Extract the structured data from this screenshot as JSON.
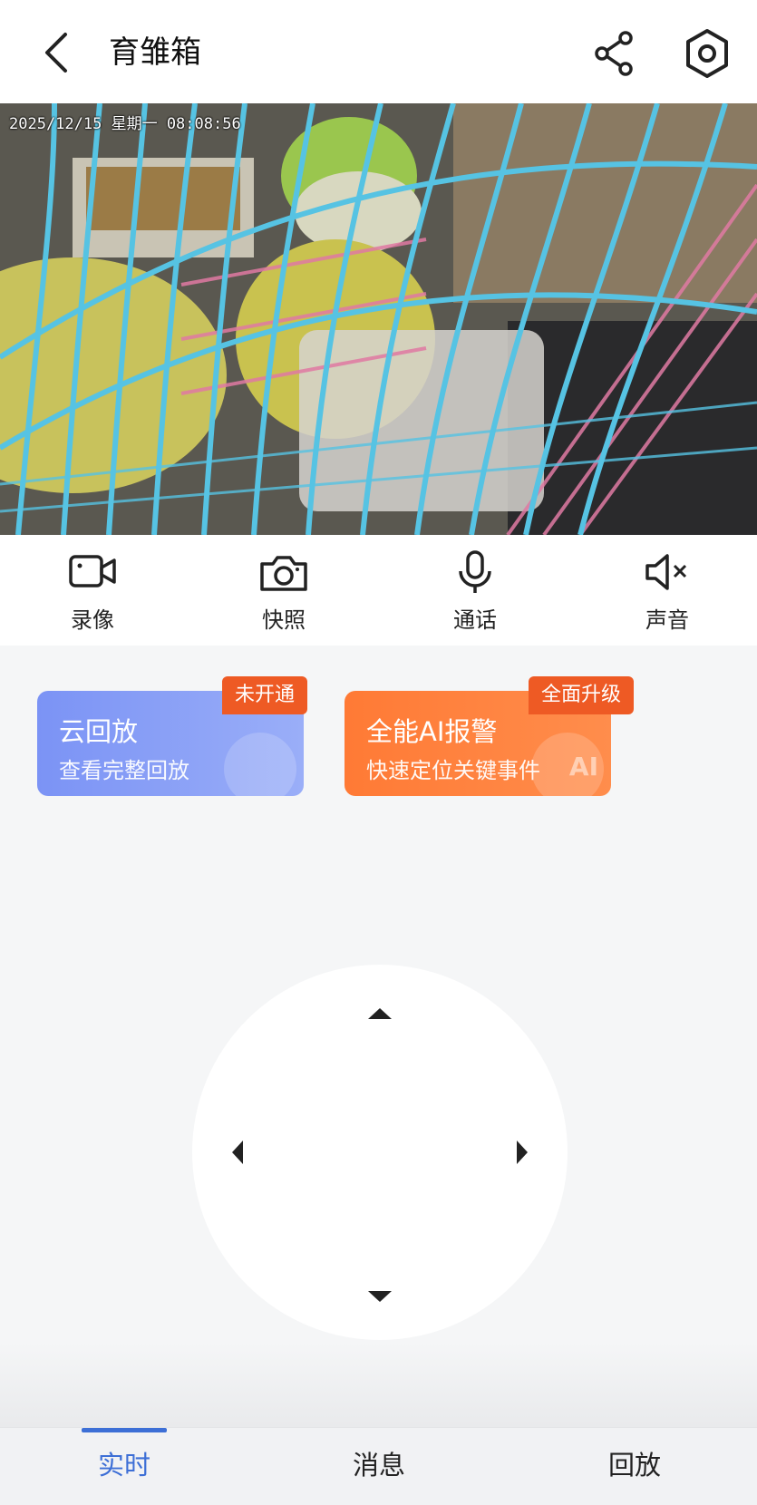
{
  "header": {
    "title": "育雏箱",
    "back_icon": "chevron-left-icon",
    "share_icon": "share-icon",
    "settings_icon": "hex-nut-settings-icon"
  },
  "video": {
    "timestamp": "2025/12/15 星期一 08:08:56"
  },
  "controls": [
    {
      "label": "录像",
      "icon": "video-record-icon"
    },
    {
      "label": "快照",
      "icon": "camera-icon"
    },
    {
      "label": "通话",
      "icon": "microphone-icon"
    },
    {
      "label": "声音",
      "icon": "speaker-muted-icon"
    }
  ],
  "cards": {
    "cloud": {
      "title": "云回放",
      "subtitle": "查看完整回放",
      "badge": "未开通",
      "color": "#7b93f5"
    },
    "ai": {
      "title": "全能AI报警",
      "subtitle": "快速定位关键事件",
      "badge": "全面升级",
      "deco": "AI",
      "color": "#ff7a35"
    }
  },
  "ptz": {
    "icons": [
      "arrow-up-icon",
      "arrow-down-icon",
      "arrow-left-icon",
      "arrow-right-icon"
    ]
  },
  "tabs": [
    {
      "label": "实时",
      "active": true
    },
    {
      "label": "消息",
      "active": false
    },
    {
      "label": "回放",
      "active": false
    }
  ],
  "colors": {
    "accent": "#3d6fd6",
    "badge": "#ee5a24"
  }
}
